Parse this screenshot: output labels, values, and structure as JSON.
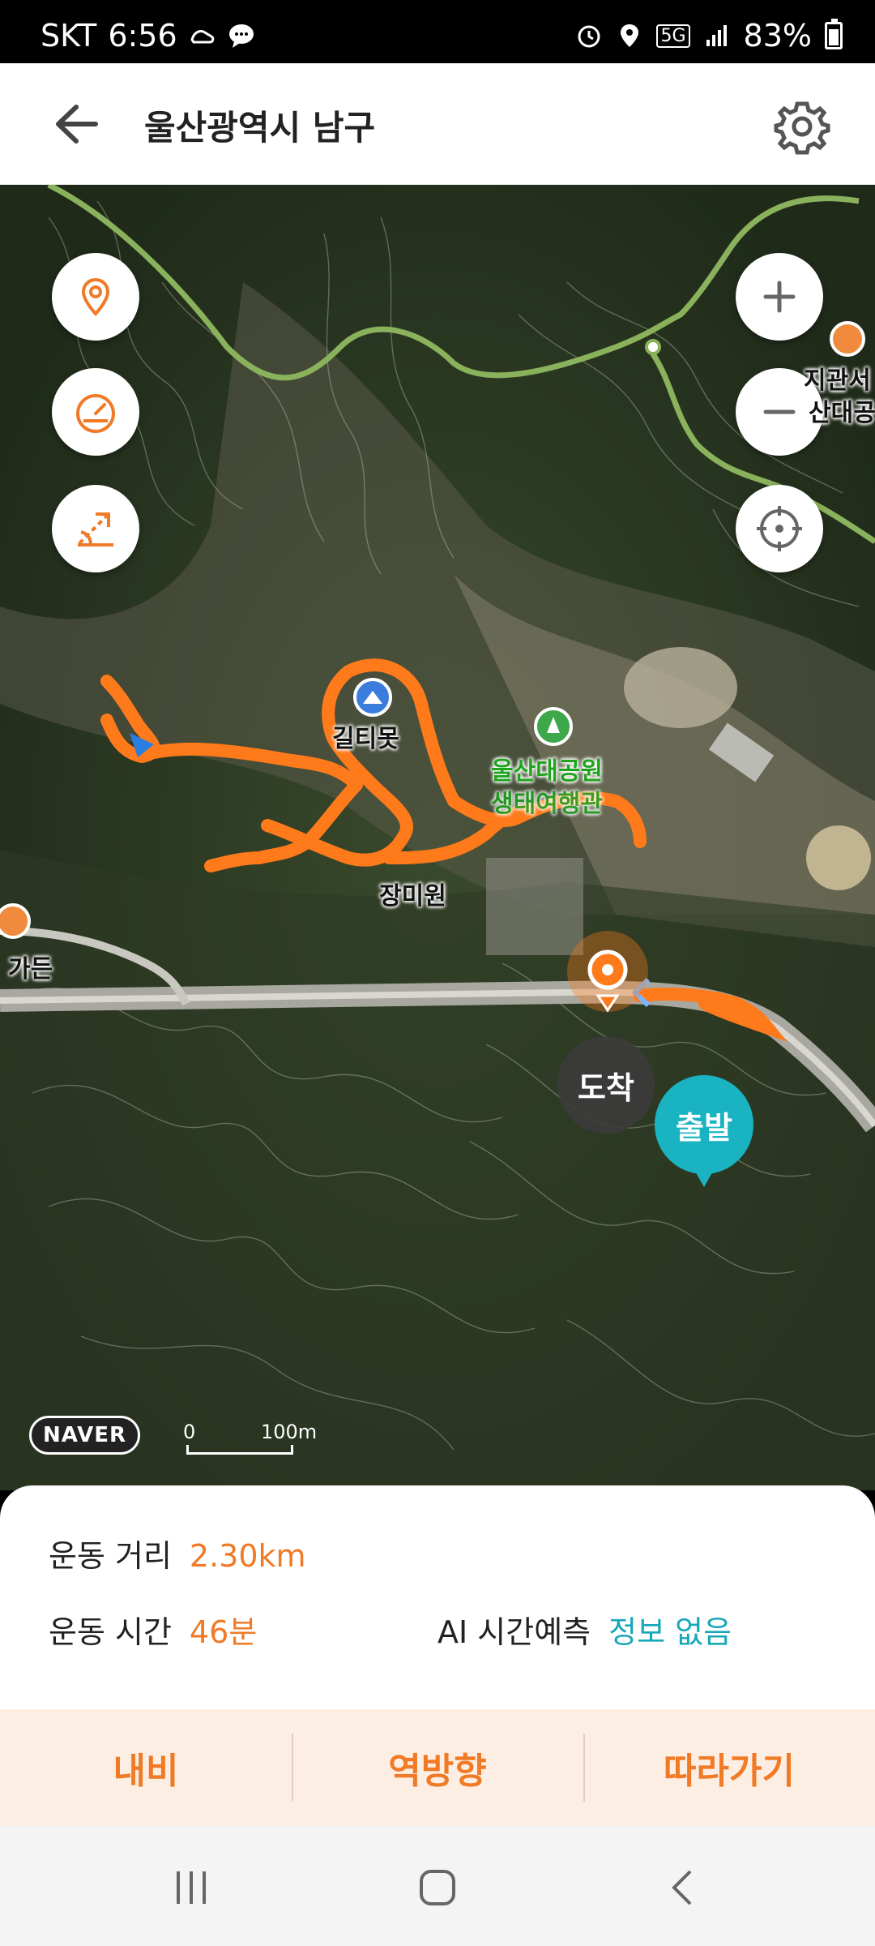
{
  "status": {
    "carrier": "SKT",
    "time": "6:56",
    "network": "5G",
    "battery": "83%"
  },
  "header": {
    "title": "울산광역시 남구"
  },
  "map": {
    "labels": {
      "pond": "길티못",
      "park": "울산대공원",
      "park_sub": "생태여행관",
      "rose_garden": "장미원",
      "restaurant": "가든",
      "right_top_1": "지관서",
      "right_top_2": "산대공"
    },
    "arrive_label": "도착",
    "start_label": "출발",
    "logo": "NAVER",
    "scale_zero": "0",
    "scale_dist": "100m"
  },
  "stats": {
    "distance_label": "운동 거리",
    "distance_value": "2.30km",
    "time_label": "운동 시간",
    "time_value": "46분",
    "ai_label": "AI 시간예측",
    "ai_value": "정보 없음"
  },
  "actions": {
    "navi": "내비",
    "reverse": "역방향",
    "follow": "따라가기"
  },
  "colors": {
    "accent": "#f07a26",
    "teal": "#17a8b8",
    "route": "#ff7a1a"
  }
}
